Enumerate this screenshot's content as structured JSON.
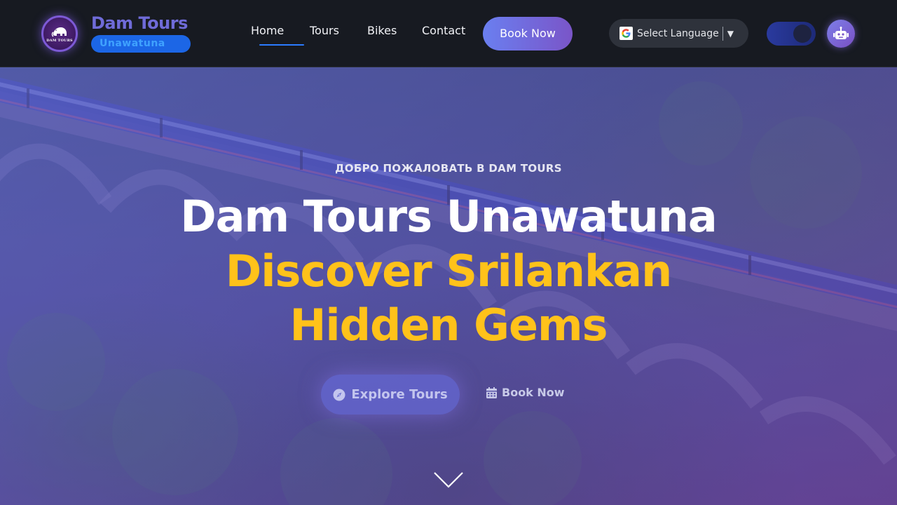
{
  "brand": {
    "title": "Dam Tours",
    "subtitle": "Unawatuna",
    "logo_text": "DAM TOURS"
  },
  "nav": {
    "items": [
      {
        "label": "Home",
        "active": true
      },
      {
        "label": "Tours"
      },
      {
        "label": "Bikes"
      },
      {
        "label": "Contact"
      }
    ],
    "book_label": "Book Now"
  },
  "language": {
    "label": "Select Language",
    "caret": "▼",
    "icon": "google-g-icon"
  },
  "theme_toggle": {
    "icon": "theme-toggle"
  },
  "chatbot": {
    "icon": "robot-icon"
  },
  "hero": {
    "welcome": "ДОБРО ПОЖАЛОВАТЬ В DAM TOURS",
    "line1": "Dam Tours Unawatuna",
    "line2": "Discover Srilankan",
    "line3": "Hidden Gems",
    "explore_label": "Explore Tours",
    "explore_icon": "compass-icon",
    "book_label": "Book Now",
    "book_icon": "calendar-icon",
    "scroll_icon": "chevron-down-icon"
  },
  "colors": {
    "accent": "#ffc21a",
    "nav_underline": "#2b7bff",
    "button_gradient_start": "#6a7ff0",
    "button_gradient_end": "#7a55c8"
  }
}
